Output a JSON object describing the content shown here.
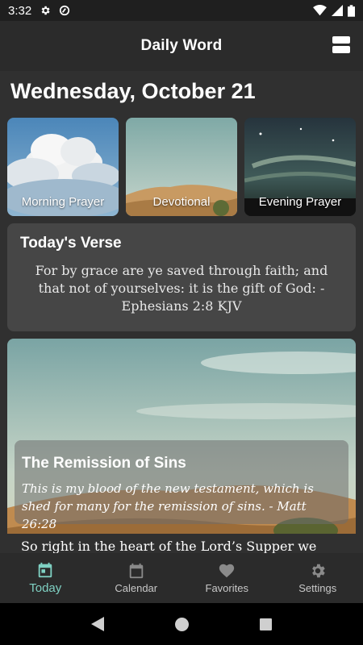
{
  "status_bar": {
    "time": "3:32"
  },
  "app_bar": {
    "title": "Daily Word"
  },
  "date_heading": "Wednesday, October 21",
  "tiles": [
    {
      "label": "Morning Prayer"
    },
    {
      "label": "Devotional"
    },
    {
      "label": "Evening Prayer"
    }
  ],
  "verse": {
    "title": "Today's Verse",
    "text": "For by grace are ye saved through faith; and that not of yourselves: it is the gift of God: - Ephesians 2:8 KJV"
  },
  "devotional": {
    "title": "The Remission of Sins",
    "quote": "This is my blood of the new testament, which is shed for many for the remission of sins. - Matt 26:28",
    "body_preview": "So right in the heart of the Lord’s Supper we are"
  },
  "bottom_nav": [
    {
      "label": "Today",
      "icon": "calendar-today-icon",
      "active": true
    },
    {
      "label": "Calendar",
      "icon": "calendar-icon",
      "active": false
    },
    {
      "label": "Favorites",
      "icon": "heart-icon",
      "active": false
    },
    {
      "label": "Settings",
      "icon": "gear-icon",
      "active": false
    }
  ],
  "colors": {
    "accent": "#7fd1c3",
    "background": "#303030",
    "card": "#464646"
  }
}
